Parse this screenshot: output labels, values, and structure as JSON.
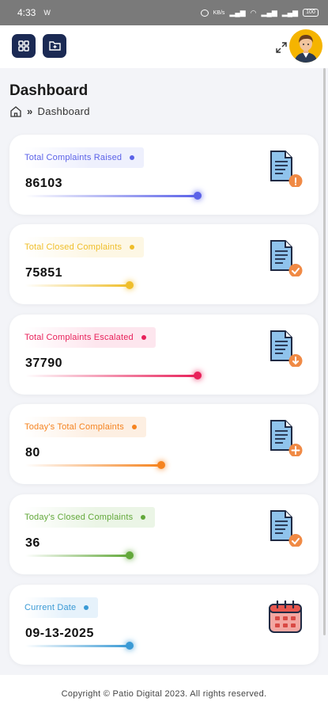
{
  "status_bar": {
    "time": "4:33",
    "battery": "100"
  },
  "header": {
    "icons": [
      "grid-icon",
      "add-folder-icon",
      "expand-icon"
    ]
  },
  "page": {
    "title": "Dashboard",
    "breadcrumb": {
      "home_icon": "home-icon",
      "separator": "»",
      "current": "Dashboard"
    }
  },
  "cards": [
    {
      "label": "Total Complaints Raised",
      "value": "86103",
      "color": "#5b62e8",
      "label_bg": "#eef0fd",
      "bar_fill": 0.86,
      "icon": "document-alert-icon",
      "badge": "#f08a45"
    },
    {
      "label": "Total Closed Complaints",
      "value": "75851",
      "color": "#efbe2a",
      "label_bg": "#fdf7e4",
      "bar_fill": 0.52,
      "icon": "document-check-icon",
      "badge": "#f08a45"
    },
    {
      "label": "Total Complaints Escalated",
      "value": "37790",
      "color": "#e8215a",
      "label_bg": "#fde6ee",
      "bar_fill": 0.86,
      "icon": "document-download-icon",
      "badge": "#f08a45"
    },
    {
      "label": "Today's Total Complaints",
      "value": "80",
      "color": "#f5831f",
      "label_bg": "#fdefe2",
      "bar_fill": 0.68,
      "icon": "document-add-icon",
      "badge": "#f08a45"
    },
    {
      "label": "Today's Closed Complaints",
      "value": "36",
      "color": "#62a83a",
      "label_bg": "#ebf5e6",
      "bar_fill": 0.52,
      "icon": "document-check-icon",
      "badge": "#f08a45"
    },
    {
      "label": "Current Date",
      "value": "09-13-2025",
      "color": "#3a9ad5",
      "label_bg": "#e6f2fb",
      "bar_fill": 0.52,
      "icon": "calendar-icon",
      "badge": "#e8574f"
    }
  ],
  "footer": {
    "text": "Copyright © Patio Digital 2023. All rights reserved."
  }
}
